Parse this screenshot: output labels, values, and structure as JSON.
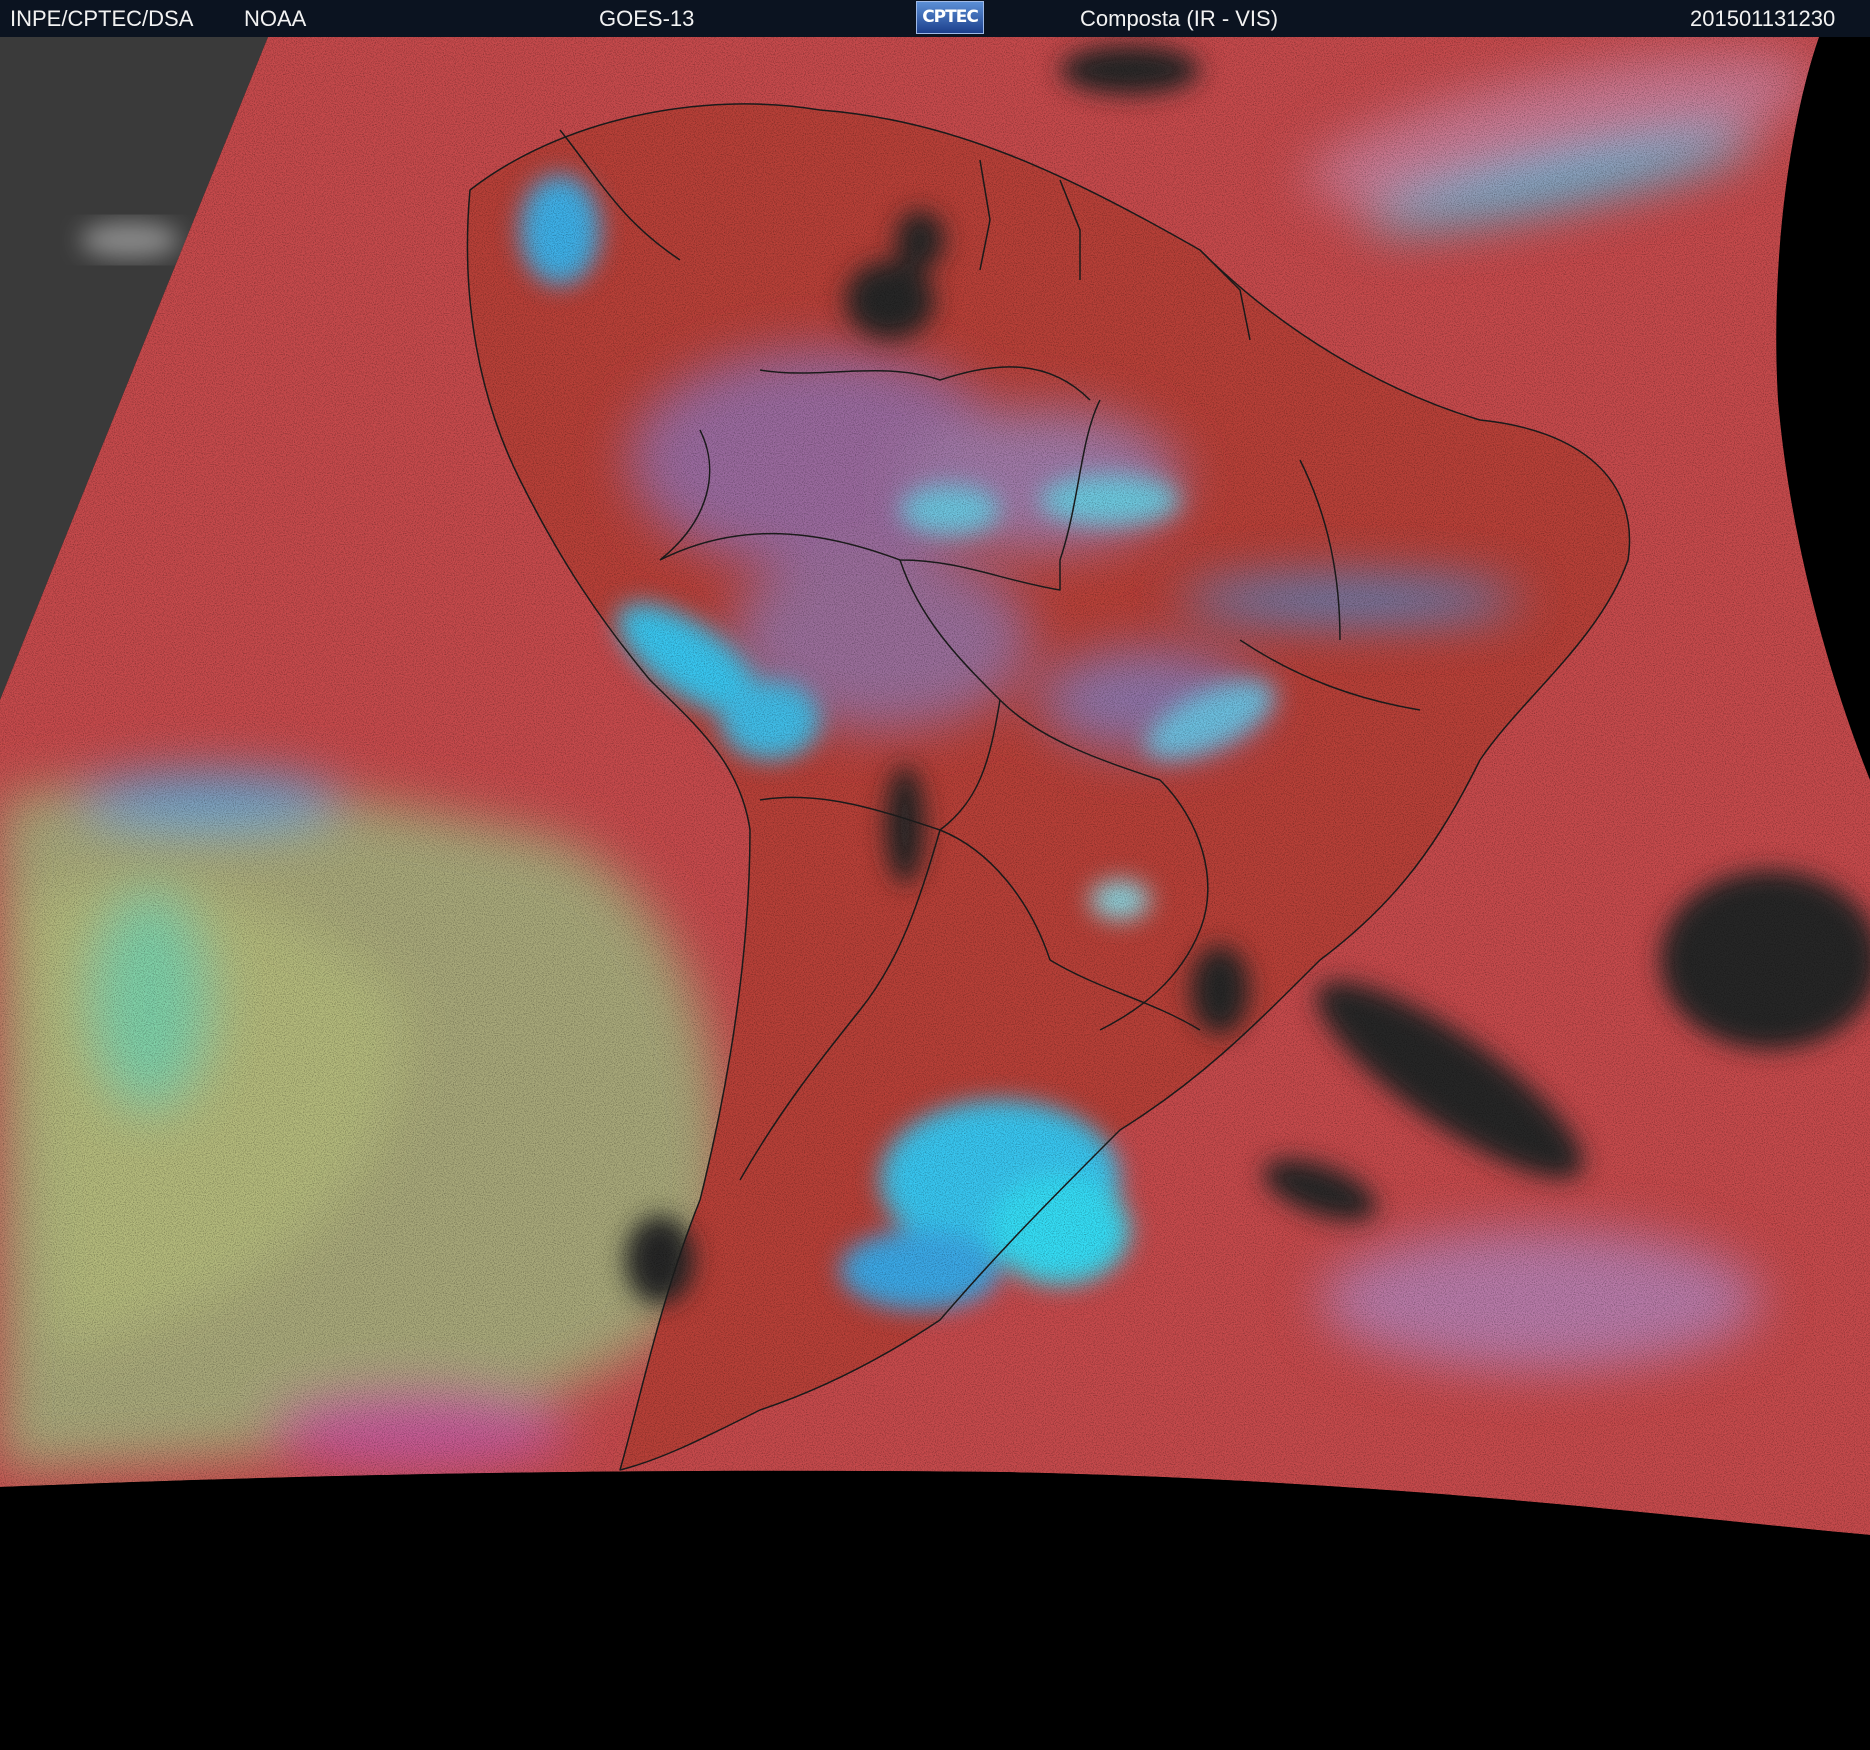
{
  "header": {
    "agency": "INPE/CPTEC/DSA",
    "source": "NOAA",
    "satellite": "GOES-13",
    "logo_text": "CPTEC",
    "product": "Composta (IR - VIS)",
    "timestamp": "201501131230"
  },
  "colors": {
    "header_bg": "#0b1320",
    "clear_ocean": "#c64a4c",
    "land_clear": "#b84038",
    "high_cloud": "#39c6f0",
    "low_cloud": "#a8a87a",
    "night_side": "#3a3a3a",
    "space": "#000000",
    "borders": "#1a1a1a"
  },
  "icons": {
    "logo": "cptec-logo-icon"
  }
}
